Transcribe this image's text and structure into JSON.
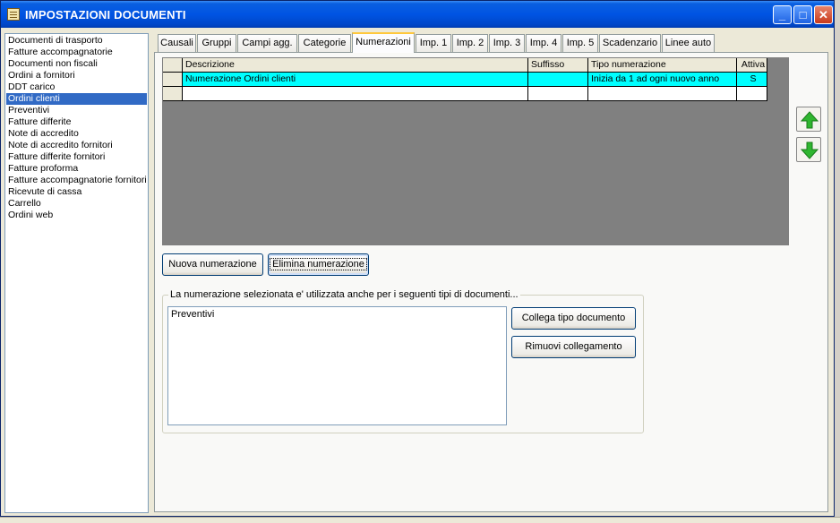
{
  "window": {
    "title": "IMPOSTAZIONI DOCUMENTI"
  },
  "doc_types": [
    "Documenti di trasporto",
    "Fatture accompagnatorie",
    "Documenti non fiscali",
    "Ordini a fornitori",
    "DDT carico",
    "Ordini clienti",
    "Preventivi",
    "Fatture differite",
    "Note di accredito",
    "Note di accredito fornitori",
    "Fatture differite fornitori",
    "Fatture proforma",
    "Fatture accompagnatorie fornitori",
    "Ricevute di cassa",
    "Carrello",
    "Ordini web"
  ],
  "selected_doc_type": "Ordini clienti",
  "tabs": [
    "Causali",
    "Gruppi",
    "Campi agg.",
    "Categorie",
    "Numerazioni",
    "Imp. 1",
    "Imp. 2",
    "Imp. 3",
    "Imp. 4",
    "Imp. 5",
    "Scadenzario",
    "Linee auto"
  ],
  "active_tab": "Numerazioni",
  "grid": {
    "columns": [
      "Descrizione",
      "Suffisso",
      "Tipo numerazione",
      "Attiva"
    ],
    "rows": [
      [
        "Numerazione Ordini clienti",
        "",
        "Inizia da 1 ad ogni nuovo anno",
        "S"
      ]
    ]
  },
  "buttons": {
    "new_numbering": "Nuova numerazione",
    "delete_numbering": "Elimina numerazione",
    "link_doc_type": "Collega tipo documento",
    "remove_link": "Rimuovi collegamento"
  },
  "linked_group": {
    "label": "La numerazione selezionata e' utilizzata anche per i seguenti tipi di documenti...",
    "items": [
      "Preventivi"
    ]
  },
  "colors": {
    "title_bar": "#0054e3",
    "selection": "#316ac5",
    "grid_selected_row": "#00ffff",
    "arrow_green": "#2fb52f"
  }
}
